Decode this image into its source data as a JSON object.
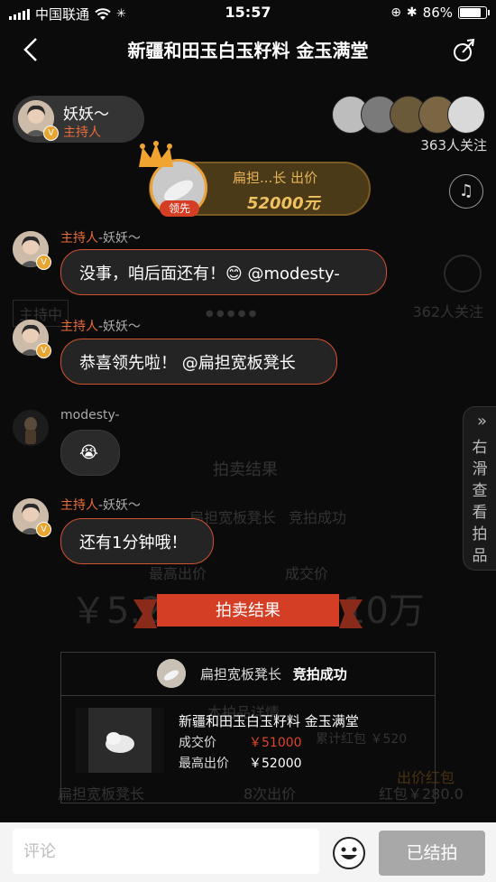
{
  "status_bar": {
    "carrier": "中国联通",
    "time": "15:57",
    "battery": "86%",
    "battery_level": 0.86
  },
  "header": {
    "title": "新疆和田玉白玉籽料 金玉满堂"
  },
  "host": {
    "name": "妖妖～",
    "role": "主持人"
  },
  "viewers": {
    "followers": "363人关注"
  },
  "lead_bid": {
    "tag": "领先",
    "bidder": "扁担...长 出价",
    "price": "52000元"
  },
  "chat": [
    {
      "role": "主持人",
      "name": "-妖妖～",
      "text": "没事，咱后面还有！😊 @modesty-"
    },
    {
      "role": "主持人",
      "name": "-妖妖～",
      "text": "恭喜领先啦！ @扁担宽板凳长"
    },
    {
      "role": "",
      "name": "modesty-",
      "text": "😭"
    },
    {
      "role": "主持人",
      "name": "-妖妖～",
      "text": "还有1分钟哦！"
    }
  ],
  "background": {
    "followers": "362人关注",
    "host_tag": "主持中",
    "result_title": "拍卖结果",
    "bid_success": "竞拍成功",
    "highest_label": "最高出价",
    "deal_label": "成交价",
    "highest_value": "￥5.2",
    "deal_value": "10万",
    "bid_count": "8次出价",
    "bidder": "扁担宽板凳长",
    "red_packet": "红包￥280.0",
    "red_label": "出价红包",
    "red_small": "累计红包 ￥520",
    "section": "本拍品详情"
  },
  "side_panel": {
    "text": "右滑查看拍品"
  },
  "auction_result": {
    "title": "拍卖结果",
    "winner": "扁担宽板凳长",
    "status": "竞拍成功",
    "item_title": "新疆和田玉白玉籽料 金玉满堂",
    "deal_label": "成交价",
    "deal_price": "￥51000",
    "highest_label": "最高出价",
    "highest_price": "￥52000"
  },
  "bottom": {
    "comment_placeholder": "评论",
    "ended_label": "已结拍"
  },
  "colors": {
    "accent": "#d2512f",
    "gold": "#e9a13a",
    "host_role": "#e86b3a"
  }
}
